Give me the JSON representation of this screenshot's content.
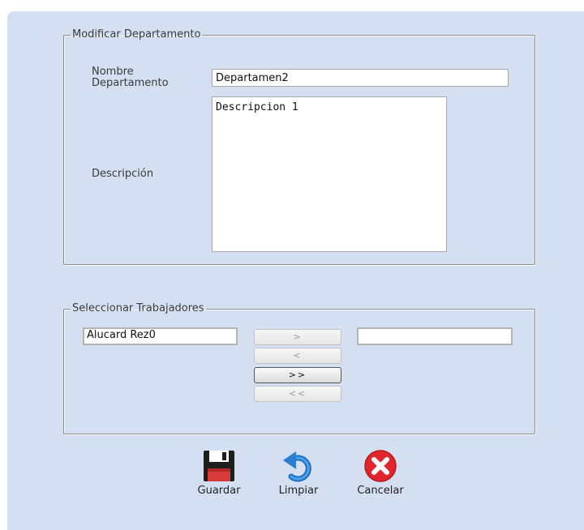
{
  "department_section": {
    "legend": "Modificar Departamento",
    "name_label": "Nombre\nDepartamento",
    "name_value": "Departamen2",
    "description_label": "Descripción",
    "description_value": "Descripcion 1"
  },
  "workers_section": {
    "legend": "Seleccionar Trabajadores",
    "available_list": [
      "Alucard Rez0"
    ],
    "selected_list": [],
    "buttons": {
      "add_one": ">",
      "remove_one": "<",
      "add_all": ">>",
      "remove_all": "<<"
    }
  },
  "actions": {
    "save_label": "Guardar",
    "clear_label": "Limpiar",
    "cancel_label": "Cancelar"
  },
  "icons": {
    "save": "floppy-disk-icon",
    "clear": "undo-arrow-icon",
    "cancel": "red-x-circle-icon"
  },
  "colors": {
    "panel_background": "#d4e0f2",
    "cancel_red": "#e0262c",
    "undo_blue": "#2a7fd0",
    "floppy_dark": "#1e1e1e"
  }
}
